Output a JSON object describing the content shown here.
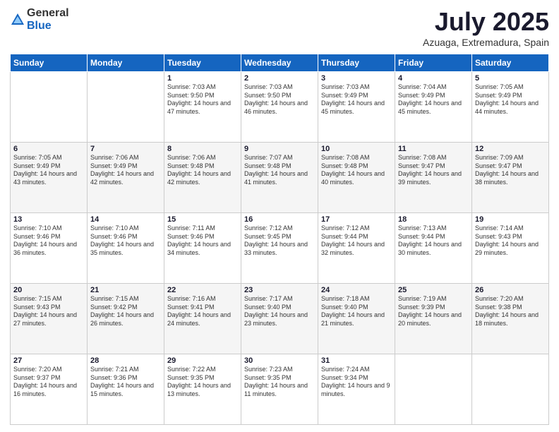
{
  "logo": {
    "general": "General",
    "blue": "Blue"
  },
  "header": {
    "month": "July 2025",
    "location": "Azuaga, Extremadura, Spain"
  },
  "weekdays": [
    "Sunday",
    "Monday",
    "Tuesday",
    "Wednesday",
    "Thursday",
    "Friday",
    "Saturday"
  ],
  "weeks": [
    [
      {
        "day": null
      },
      {
        "day": null
      },
      {
        "day": "1",
        "sunrise": "Sunrise: 7:03 AM",
        "sunset": "Sunset: 9:50 PM",
        "daylight": "Daylight: 14 hours and 47 minutes."
      },
      {
        "day": "2",
        "sunrise": "Sunrise: 7:03 AM",
        "sunset": "Sunset: 9:50 PM",
        "daylight": "Daylight: 14 hours and 46 minutes."
      },
      {
        "day": "3",
        "sunrise": "Sunrise: 7:03 AM",
        "sunset": "Sunset: 9:49 PM",
        "daylight": "Daylight: 14 hours and 45 minutes."
      },
      {
        "day": "4",
        "sunrise": "Sunrise: 7:04 AM",
        "sunset": "Sunset: 9:49 PM",
        "daylight": "Daylight: 14 hours and 45 minutes."
      },
      {
        "day": "5",
        "sunrise": "Sunrise: 7:05 AM",
        "sunset": "Sunset: 9:49 PM",
        "daylight": "Daylight: 14 hours and 44 minutes."
      }
    ],
    [
      {
        "day": "6",
        "sunrise": "Sunrise: 7:05 AM",
        "sunset": "Sunset: 9:49 PM",
        "daylight": "Daylight: 14 hours and 43 minutes."
      },
      {
        "day": "7",
        "sunrise": "Sunrise: 7:06 AM",
        "sunset": "Sunset: 9:49 PM",
        "daylight": "Daylight: 14 hours and 42 minutes."
      },
      {
        "day": "8",
        "sunrise": "Sunrise: 7:06 AM",
        "sunset": "Sunset: 9:48 PM",
        "daylight": "Daylight: 14 hours and 42 minutes."
      },
      {
        "day": "9",
        "sunrise": "Sunrise: 7:07 AM",
        "sunset": "Sunset: 9:48 PM",
        "daylight": "Daylight: 14 hours and 41 minutes."
      },
      {
        "day": "10",
        "sunrise": "Sunrise: 7:08 AM",
        "sunset": "Sunset: 9:48 PM",
        "daylight": "Daylight: 14 hours and 40 minutes."
      },
      {
        "day": "11",
        "sunrise": "Sunrise: 7:08 AM",
        "sunset": "Sunset: 9:47 PM",
        "daylight": "Daylight: 14 hours and 39 minutes."
      },
      {
        "day": "12",
        "sunrise": "Sunrise: 7:09 AM",
        "sunset": "Sunset: 9:47 PM",
        "daylight": "Daylight: 14 hours and 38 minutes."
      }
    ],
    [
      {
        "day": "13",
        "sunrise": "Sunrise: 7:10 AM",
        "sunset": "Sunset: 9:46 PM",
        "daylight": "Daylight: 14 hours and 36 minutes."
      },
      {
        "day": "14",
        "sunrise": "Sunrise: 7:10 AM",
        "sunset": "Sunset: 9:46 PM",
        "daylight": "Daylight: 14 hours and 35 minutes."
      },
      {
        "day": "15",
        "sunrise": "Sunrise: 7:11 AM",
        "sunset": "Sunset: 9:46 PM",
        "daylight": "Daylight: 14 hours and 34 minutes."
      },
      {
        "day": "16",
        "sunrise": "Sunrise: 7:12 AM",
        "sunset": "Sunset: 9:45 PM",
        "daylight": "Daylight: 14 hours and 33 minutes."
      },
      {
        "day": "17",
        "sunrise": "Sunrise: 7:12 AM",
        "sunset": "Sunset: 9:44 PM",
        "daylight": "Daylight: 14 hours and 32 minutes."
      },
      {
        "day": "18",
        "sunrise": "Sunrise: 7:13 AM",
        "sunset": "Sunset: 9:44 PM",
        "daylight": "Daylight: 14 hours and 30 minutes."
      },
      {
        "day": "19",
        "sunrise": "Sunrise: 7:14 AM",
        "sunset": "Sunset: 9:43 PM",
        "daylight": "Daylight: 14 hours and 29 minutes."
      }
    ],
    [
      {
        "day": "20",
        "sunrise": "Sunrise: 7:15 AM",
        "sunset": "Sunset: 9:43 PM",
        "daylight": "Daylight: 14 hours and 27 minutes."
      },
      {
        "day": "21",
        "sunrise": "Sunrise: 7:15 AM",
        "sunset": "Sunset: 9:42 PM",
        "daylight": "Daylight: 14 hours and 26 minutes."
      },
      {
        "day": "22",
        "sunrise": "Sunrise: 7:16 AM",
        "sunset": "Sunset: 9:41 PM",
        "daylight": "Daylight: 14 hours and 24 minutes."
      },
      {
        "day": "23",
        "sunrise": "Sunrise: 7:17 AM",
        "sunset": "Sunset: 9:40 PM",
        "daylight": "Daylight: 14 hours and 23 minutes."
      },
      {
        "day": "24",
        "sunrise": "Sunrise: 7:18 AM",
        "sunset": "Sunset: 9:40 PM",
        "daylight": "Daylight: 14 hours and 21 minutes."
      },
      {
        "day": "25",
        "sunrise": "Sunrise: 7:19 AM",
        "sunset": "Sunset: 9:39 PM",
        "daylight": "Daylight: 14 hours and 20 minutes."
      },
      {
        "day": "26",
        "sunrise": "Sunrise: 7:20 AM",
        "sunset": "Sunset: 9:38 PM",
        "daylight": "Daylight: 14 hours and 18 minutes."
      }
    ],
    [
      {
        "day": "27",
        "sunrise": "Sunrise: 7:20 AM",
        "sunset": "Sunset: 9:37 PM",
        "daylight": "Daylight: 14 hours and 16 minutes."
      },
      {
        "day": "28",
        "sunrise": "Sunrise: 7:21 AM",
        "sunset": "Sunset: 9:36 PM",
        "daylight": "Daylight: 14 hours and 15 minutes."
      },
      {
        "day": "29",
        "sunrise": "Sunrise: 7:22 AM",
        "sunset": "Sunset: 9:35 PM",
        "daylight": "Daylight: 14 hours and 13 minutes."
      },
      {
        "day": "30",
        "sunrise": "Sunrise: 7:23 AM",
        "sunset": "Sunset: 9:35 PM",
        "daylight": "Daylight: 14 hours and 11 minutes."
      },
      {
        "day": "31",
        "sunrise": "Sunrise: 7:24 AM",
        "sunset": "Sunset: 9:34 PM",
        "daylight": "Daylight: 14 hours and 9 minutes."
      },
      {
        "day": null
      },
      {
        "day": null
      }
    ]
  ]
}
